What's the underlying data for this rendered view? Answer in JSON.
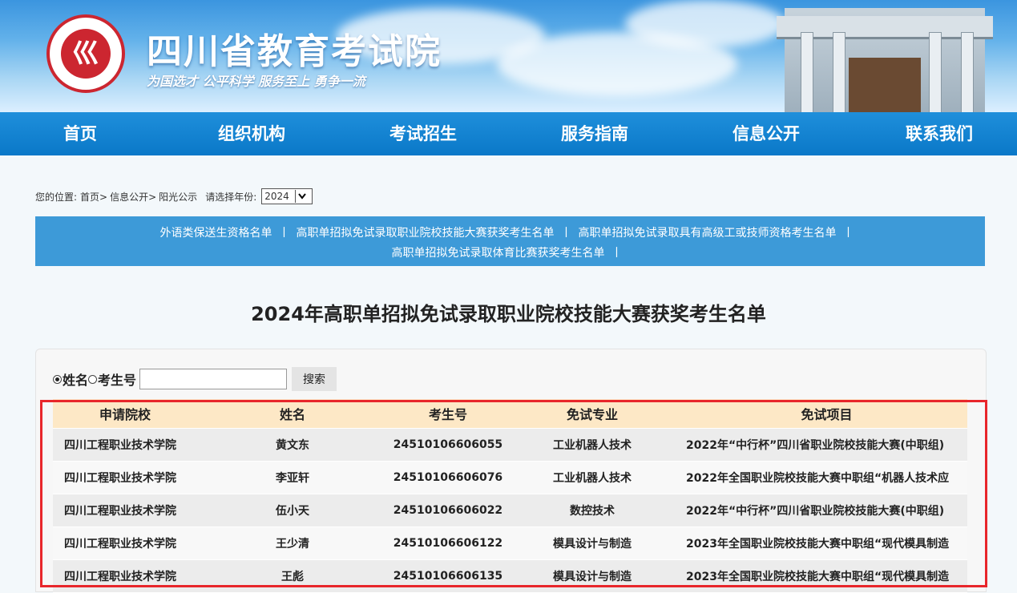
{
  "header": {
    "site_title": "四川省教育考试院",
    "slogan": "为国选才 公平科学 服务至上 勇争一流",
    "logo_glyph": "巛"
  },
  "nav": {
    "items": [
      "首页",
      "组织机构",
      "考试招生",
      "服务指南",
      "信息公开",
      "联系我们"
    ]
  },
  "breadcrumb": {
    "prefix": "您的位置:",
    "path": [
      "首页>",
      "信息公开>",
      "阳光公示"
    ],
    "year_label": "请选择年份:",
    "year_value": "2024"
  },
  "links": {
    "line1": [
      "外语类保送生资格名单",
      "高职单招拟免试录取职业院校技能大赛获奖考生名单",
      "高职单招拟免试录取具有高级工或技师资格考生名单"
    ],
    "line2": [
      "高职单招拟免试录取体育比赛获奖考生名单"
    ],
    "separator": "丨"
  },
  "page_title": "2024年高职单招拟免试录取职业院校技能大赛获奖考生名单",
  "search": {
    "option_name": "姓名",
    "option_id": "考生号",
    "selected": "姓名",
    "input_value": "",
    "button_label": "搜索"
  },
  "table": {
    "columns": [
      "申请院校",
      "姓名",
      "考生号",
      "免试专业",
      "免试项目"
    ],
    "rows": [
      [
        "四川工程职业技术学院",
        "黄文东",
        "24510106606055",
        "工业机器人技术",
        "2022年“中行杯”四川省职业院校技能大赛(中职组)"
      ],
      [
        "四川工程职业技术学院",
        "李亚轩",
        "24510106606076",
        "工业机器人技术",
        "2022年全国职业院校技能大赛中职组“机器人技术应"
      ],
      [
        "四川工程职业技术学院",
        "伍小天",
        "24510106606022",
        "数控技术",
        "2022年“中行杯”四川省职业院校技能大赛(中职组)"
      ],
      [
        "四川工程职业技术学院",
        "王少清",
        "24510106606122",
        "模具设计与制造",
        "2023年全国职业院校技能大赛中职组“现代模具制造"
      ],
      [
        "四川工程职业技术学院",
        "王彪",
        "24510106606135",
        "模具设计与制造",
        "2023年全国职业院校技能大赛中职组“现代模具制造"
      ]
    ]
  },
  "colors": {
    "nav_bg": "#0a78c8",
    "link_box_bg": "#3d9ad8",
    "table_head_bg": "#fde8c6",
    "highlight_border": "#e8262b",
    "logo_red": "#cc2630"
  }
}
